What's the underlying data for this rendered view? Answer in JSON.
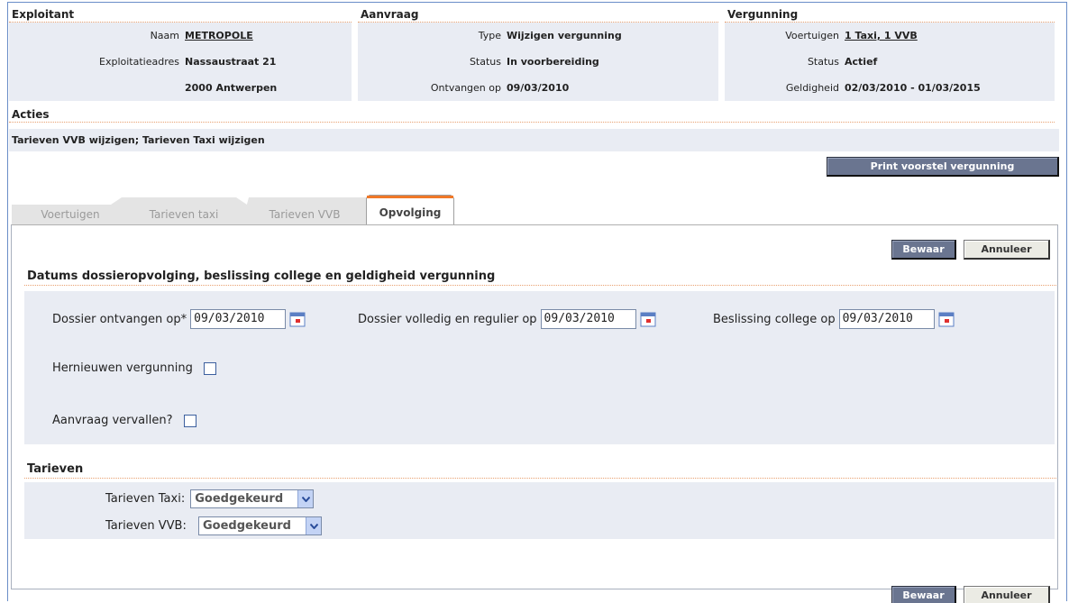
{
  "exploitant": {
    "title": "Exploitant",
    "naam_label": "Naam",
    "naam_value": "METROPOLE",
    "adres_label": "Exploitatieadres",
    "adres_line1": "Nassaustraat 21",
    "adres_line2": "2000 Antwerpen"
  },
  "aanvraag": {
    "title": "Aanvraag",
    "type_label": "Type",
    "type_value": "Wijzigen vergunning",
    "status_label": "Status",
    "status_value": "In voorbereiding",
    "ontvangen_label": "Ontvangen op",
    "ontvangen_value": "09/03/2010"
  },
  "vergunning": {
    "title": "Vergunning",
    "voertuigen_label": "Voertuigen",
    "voertuigen_value": "1 Taxi, 1 VVB",
    "status_label": "Status",
    "status_value": "Actief",
    "geldigheid_label": "Geldigheid",
    "geldigheid_value": "02/03/2010 - 01/03/2015"
  },
  "acties": {
    "title": "Acties",
    "text": "Tarieven VVB wijzigen; Tarieven Taxi wijzigen"
  },
  "print_button": "Print voorstel vergunning",
  "tabs": [
    {
      "label": "Voertuigen",
      "active": false
    },
    {
      "label": "Tarieven taxi",
      "active": false
    },
    {
      "label": "Tarieven VVB",
      "active": false
    },
    {
      "label": "Opvolging",
      "active": true
    }
  ],
  "buttons": {
    "save": "Bewaar",
    "cancel": "Annuleer"
  },
  "datums": {
    "title": "Datums dossieropvolging, beslissing college en geldigheid vergunning",
    "dossier_ontvangen_label": "Dossier ontvangen op*",
    "dossier_ontvangen_value": "09/03/2010",
    "dossier_volledig_label": "Dossier volledig en regulier op",
    "dossier_volledig_value": "09/03/2010",
    "beslissing_label": "Beslissing college op",
    "beslissing_value": "09/03/2010",
    "hernieuwen_label": "Hernieuwen vergunning",
    "vervallen_label": "Aanvraag vervallen?"
  },
  "tarieven": {
    "title": "Tarieven",
    "taxi_label": "Tarieven Taxi:",
    "taxi_value": "Goedgekeurd",
    "vvb_label": "Tarieven VVB:",
    "vvb_value": "Goedgekeurd"
  },
  "colors": {
    "active_tab_accent": "#f07828",
    "button_dark": "#6a7590",
    "panel_bg": "#e9ecf3"
  }
}
